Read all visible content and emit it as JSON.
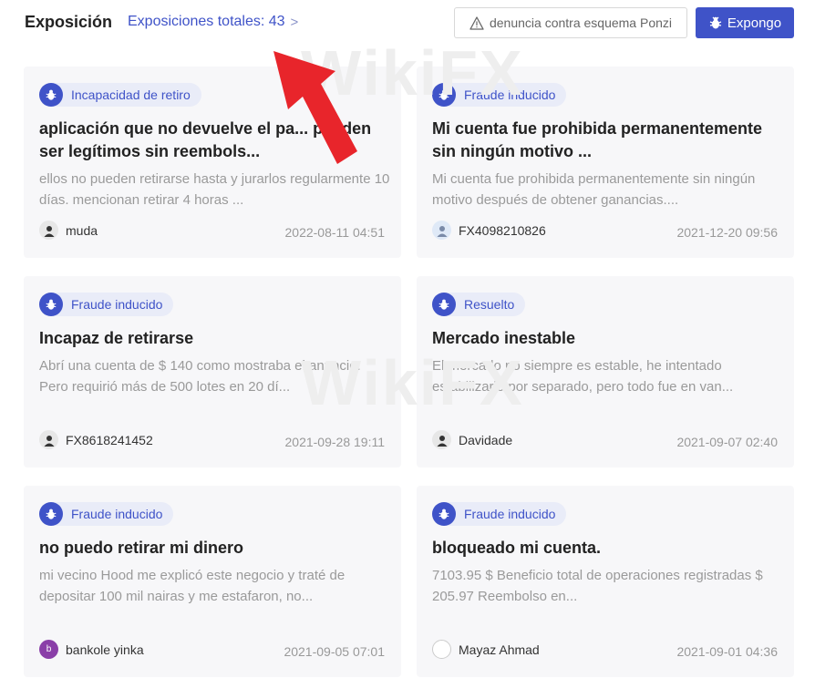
{
  "header": {
    "title": "Exposición",
    "total_link": "Exposiciones totales: 43",
    "total_chevron": ">",
    "ponzi_button": "denuncia contra esquema Ponzi",
    "expose_button": "Expongo"
  },
  "cards": [
    {
      "tag": "Incapacidad de retiro",
      "title": "aplicación que no devuelve el pa... pueden ser legítimos sin reembols...",
      "description": "ellos no pueden retirarse hasta y jurarlos regularmente 10 días. mencionan retirar 4 horas ...",
      "user": "muda",
      "avatar": "default-user",
      "date": "2022-08-11 04:51"
    },
    {
      "tag": "Fraude inducido",
      "title": "Mi cuenta fue prohibida permanentemente sin ningún motivo ...",
      "description": "Mi cuenta fue prohibida permanentemente sin ningún motivo después de obtener ganancias....",
      "user": "FX4098210826",
      "avatar": "blue-user",
      "date": "2021-12-20 09:56"
    },
    {
      "tag": "Fraude inducido",
      "title": "Incapaz de retirarse",
      "description": "Abrí una cuenta de $ 140 como mostraba el anuncio. Pero requirió más de 500 lotes en 20 dí...",
      "user": "FX8618241452",
      "avatar": "default-user",
      "date": "2021-09-28 19:11"
    },
    {
      "tag": "Resuelto",
      "title": "Mercado inestable",
      "description": "El mercado no siempre es estable, he intentado estabilizarlo por separado, pero todo fue en van...",
      "user": "Davidade",
      "avatar": "default-user",
      "date": "2021-09-07 02:40"
    },
    {
      "tag": "Fraude inducido",
      "title": "no puedo retirar mi dinero",
      "description": "mi vecino Hood me explicó este negocio y traté de depositar 100 mil nairas y me estafaron, no...",
      "user": "bankole yinka",
      "avatar": "letter-b",
      "avatar_letter": "b",
      "date": "2021-09-05 07:01"
    },
    {
      "tag": "Fraude inducido",
      "title": "bloqueado mi cuenta.",
      "description": "7103.95 $ Beneficio total de operaciones registradas $ 205.97 Reembolso en...",
      "user": "Mayaz Ahmad",
      "avatar": "empty",
      "date": "2021-09-01 04:36"
    }
  ],
  "watermark": "WikiFX",
  "colors": {
    "accent": "#3f53c8",
    "tag_bg": "#e9ecf8",
    "card_bg": "#f7f7f9",
    "arrow": "#e8252b"
  }
}
